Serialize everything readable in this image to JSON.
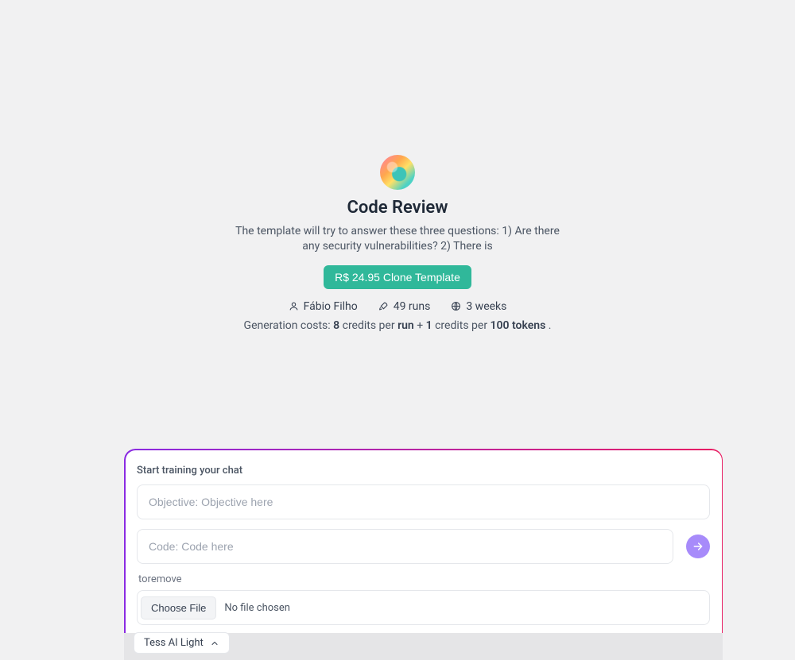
{
  "template": {
    "title": "Code Review",
    "description": "The template will try to answer these three questions: 1) Are there any security vulnerabilities? 2) There is",
    "clone_button": "R$ 24.95 Clone Template",
    "author": "Fábio Filho",
    "runs": "49 runs",
    "age": "3 weeks",
    "costs": {
      "prefix": "Generation costs: ",
      "credits_per_run": "8",
      "mid1": " credits per ",
      "run_word": "run",
      "mid2": " + ",
      "credits_per_tokens": "1",
      "mid3": " credits per ",
      "tokens_word": "100 tokens",
      "suffix": " ."
    }
  },
  "chat": {
    "header": "Start training your chat",
    "objective_placeholder": "Objective: Objective here",
    "code_placeholder": "Code: Code here",
    "toremove_label": "toremove",
    "choose_file_label": "Choose File",
    "file_status": "No file chosen",
    "model_selection": "Tess AI Light"
  }
}
